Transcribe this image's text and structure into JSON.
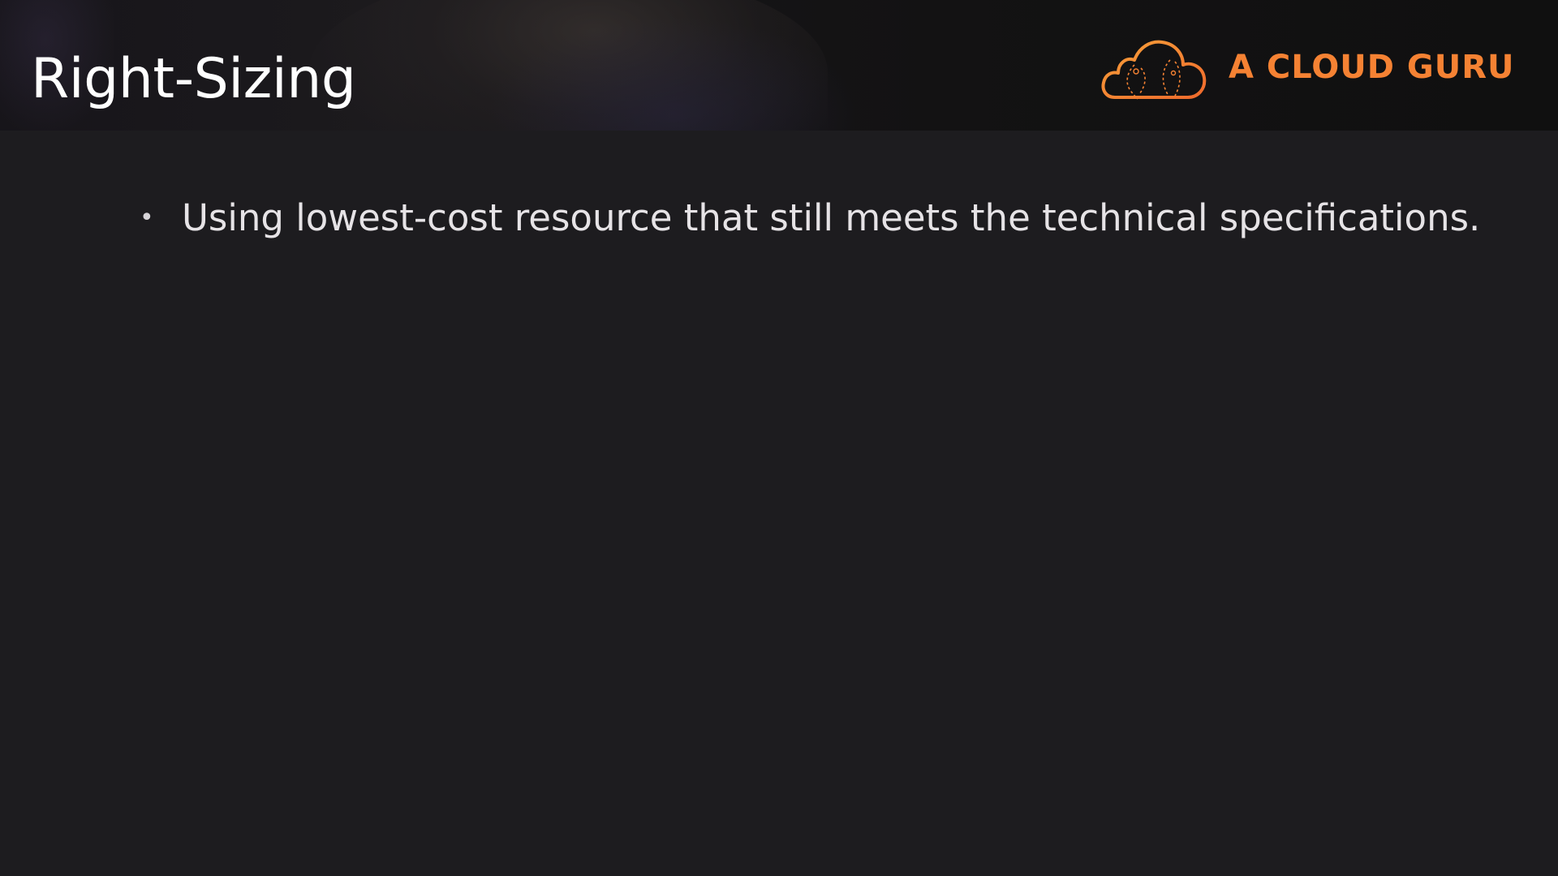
{
  "slide": {
    "title": "Right-Sizing",
    "bullets": [
      "Using lowest-cost resource that still meets the technical specifications."
    ]
  },
  "logo": {
    "text": "A CLOUD GURU",
    "icon": "cloud-icon",
    "color": "#f58233"
  },
  "colors": {
    "background": "#1d1c1f",
    "title": "#ffffff",
    "body_text": "#e6e3e6",
    "accent": "#f58233"
  }
}
